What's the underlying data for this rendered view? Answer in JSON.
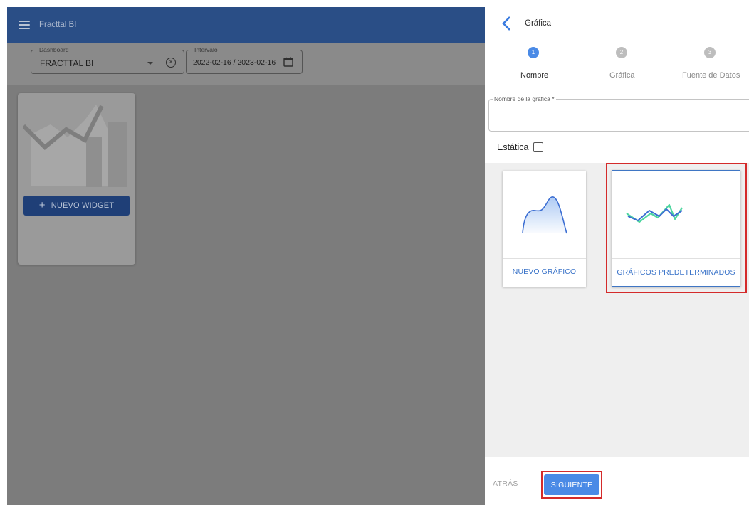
{
  "app_bar": {
    "title": "Fracttal BI"
  },
  "filters": {
    "dashboard": {
      "legend": "Dashboard",
      "value": "FRACTTAL BI"
    },
    "interval": {
      "legend": "Intervalo",
      "value": "2022-02-16 / 2023-02-16"
    }
  },
  "widget": {
    "new_button_label": "NUEVO WIDGET"
  },
  "panel": {
    "title": "Gráfica",
    "steps": [
      {
        "number": "1",
        "label": "Nombre"
      },
      {
        "number": "2",
        "label": "Gráfica"
      },
      {
        "number": "3",
        "label": "Fuente de Datos"
      }
    ],
    "name_field": {
      "legend": "Nombre de la gráfica *",
      "value": ""
    },
    "static_label": "Estática",
    "cards": [
      {
        "label": "NUEVO GRÁFICO"
      },
      {
        "label": "GRÁFICOS PREDETERMINADOS"
      }
    ],
    "back_label": "ATRÁS",
    "next_label": "SIGUIENTE"
  },
  "colors": {
    "app_bar": "#2a4e86",
    "primary": "#4a8ae6",
    "card_text": "#3b74c9",
    "highlight": "#d42b2b",
    "line_blue": "#3d6fd3",
    "line_green": "#4fd6a0"
  }
}
